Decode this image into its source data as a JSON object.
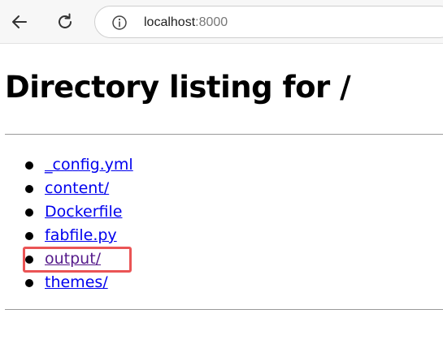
{
  "browser": {
    "url_host": "localhost",
    "url_port": ":8000",
    "icons": {
      "back": "back-arrow-icon",
      "reload": "reload-icon",
      "info": "info-icon"
    }
  },
  "page": {
    "heading": "Directory listing for /",
    "files": [
      {
        "name": "_config.yml",
        "visited": false
      },
      {
        "name": "content/",
        "visited": false
      },
      {
        "name": "Dockerfile",
        "visited": false
      },
      {
        "name": "fabfile.py",
        "visited": false
      },
      {
        "name": "output/",
        "visited": true,
        "highlighted": true
      },
      {
        "name": "themes/",
        "visited": false
      }
    ]
  },
  "colors": {
    "link": "#0000ee",
    "visited_link": "#551a8b",
    "highlight": "#ea5455"
  }
}
